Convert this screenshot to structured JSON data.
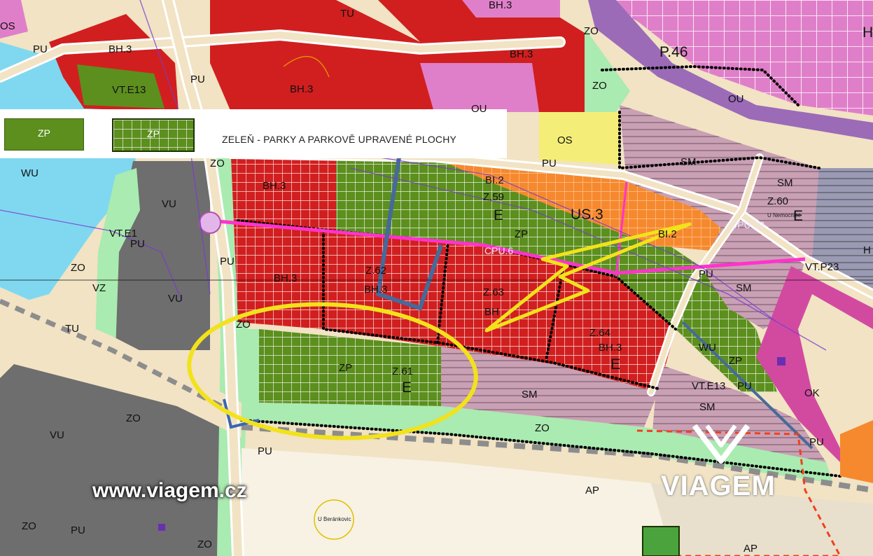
{
  "legend": {
    "swatch_solid_code": "ZP",
    "swatch_grid_code": "ZP",
    "description": "ZELEŇ - PARKY A PARKOVĚ UPRAVENÉ PLOCHY"
  },
  "colors": {
    "park_green": "#5c8f1e",
    "residential_red": "#d11f1f",
    "mixed_pink": "#c9a0b4",
    "public_magenta": "#d24aa0",
    "production_purple": "#e07fc9",
    "industry_gray": "#6e6e6e",
    "water_blue": "#7fd8f0",
    "highlight_yellow": "#f2e21b",
    "roadway_tan": "#f1e3c4"
  },
  "map_labels": [
    {
      "id": "os-top-left",
      "text": "OS"
    },
    {
      "id": "pu-1",
      "text": "PU"
    },
    {
      "id": "bh3-1",
      "text": "BH.3"
    },
    {
      "id": "tu-top",
      "text": "TU"
    },
    {
      "id": "bh3-top",
      "text": "BH.3"
    },
    {
      "id": "zo-top",
      "text": "ZO"
    },
    {
      "id": "p46",
      "text": "P.46"
    },
    {
      "id": "bh3-2",
      "text": "BH.3"
    },
    {
      "id": "vte13",
      "text": "VT.E13"
    },
    {
      "id": "pu-2",
      "text": "PU"
    },
    {
      "id": "bh3-3",
      "text": "BH.3"
    },
    {
      "id": "ou-1",
      "text": "OU"
    },
    {
      "id": "zo-2",
      "text": "ZO"
    },
    {
      "id": "ou-2",
      "text": "OU"
    },
    {
      "id": "os-2",
      "text": "OS"
    },
    {
      "id": "wu-1",
      "text": "WU"
    },
    {
      "id": "zo-3",
      "text": "ZO"
    },
    {
      "id": "pu-3",
      "text": "PU"
    },
    {
      "id": "sm-1",
      "text": "SM"
    },
    {
      "id": "bh3-4",
      "text": "BH.3"
    },
    {
      "id": "bi2-1",
      "text": "BI.2"
    },
    {
      "id": "sm-2",
      "text": "SM"
    },
    {
      "id": "vu-1",
      "text": "VU"
    },
    {
      "id": "z59",
      "text": "Z.59"
    },
    {
      "id": "us3",
      "text": "US.3"
    },
    {
      "id": "z60",
      "text": "Z.60"
    },
    {
      "id": "e-1",
      "text": "E"
    },
    {
      "id": "e-2",
      "text": "E"
    },
    {
      "id": "cpu12",
      "text": "CPU.12"
    },
    {
      "id": "vte1",
      "text": "VT.E1"
    },
    {
      "id": "zp-1",
      "text": "ZP"
    },
    {
      "id": "bi2-2",
      "text": "BI.2"
    },
    {
      "id": "pu-4",
      "text": "PU"
    },
    {
      "id": "cpu6",
      "text": "CPU.6"
    },
    {
      "id": "zo-4",
      "text": "ZO"
    },
    {
      "id": "pu-5",
      "text": "PU"
    },
    {
      "id": "vtp23",
      "text": "VT.P23"
    },
    {
      "id": "vz",
      "text": "VZ"
    },
    {
      "id": "bh3-5",
      "text": "BH.3"
    },
    {
      "id": "z62",
      "text": "Z.62"
    },
    {
      "id": "bh3-6",
      "text": "BH.3"
    },
    {
      "id": "z63",
      "text": "Z.63"
    },
    {
      "id": "pu-6",
      "text": "PU"
    },
    {
      "id": "sm-3",
      "text": "SM"
    },
    {
      "id": "vu-2",
      "text": "VU"
    },
    {
      "id": "bh-7",
      "text": "BH"
    },
    {
      "id": "tu-2",
      "text": "TU"
    },
    {
      "id": "zo-5",
      "text": "ZO"
    },
    {
      "id": "z64",
      "text": "Z.64"
    },
    {
      "id": "bh3-8",
      "text": "BH.3"
    },
    {
      "id": "wu-2",
      "text": "WU"
    },
    {
      "id": "e-3",
      "text": "E"
    },
    {
      "id": "zp-2",
      "text": "ZP"
    },
    {
      "id": "z61",
      "text": "Z.61"
    },
    {
      "id": "zp-3",
      "text": "ZP"
    },
    {
      "id": "e-4",
      "text": "E"
    },
    {
      "id": "vte13-2",
      "text": "VT.E13"
    },
    {
      "id": "pu-7",
      "text": "PU"
    },
    {
      "id": "sm-4",
      "text": "SM"
    },
    {
      "id": "ok",
      "text": "OK"
    },
    {
      "id": "sm-5",
      "text": "SM"
    },
    {
      "id": "zo-6",
      "text": "ZO"
    },
    {
      "id": "vu-3",
      "text": "VU"
    },
    {
      "id": "zo-7",
      "text": "ZO"
    },
    {
      "id": "pu-8",
      "text": "PU"
    },
    {
      "id": "pu-9",
      "text": "PU"
    },
    {
      "id": "ap-1",
      "text": "AP"
    },
    {
      "id": "zo-8",
      "text": "ZO"
    },
    {
      "id": "pu-10",
      "text": "PU"
    },
    {
      "id": "zo-9",
      "text": "ZO"
    },
    {
      "id": "ap-2",
      "text": "AP"
    },
    {
      "id": "h-1",
      "text": "H"
    },
    {
      "id": "h-2",
      "text": "H"
    },
    {
      "id": "street-1",
      "text": "U Beránkovic"
    },
    {
      "id": "street-2",
      "text": "U Nemocnice"
    }
  ],
  "watermark": {
    "url": "www.viagem.cz",
    "brand": "VIAGEM"
  }
}
